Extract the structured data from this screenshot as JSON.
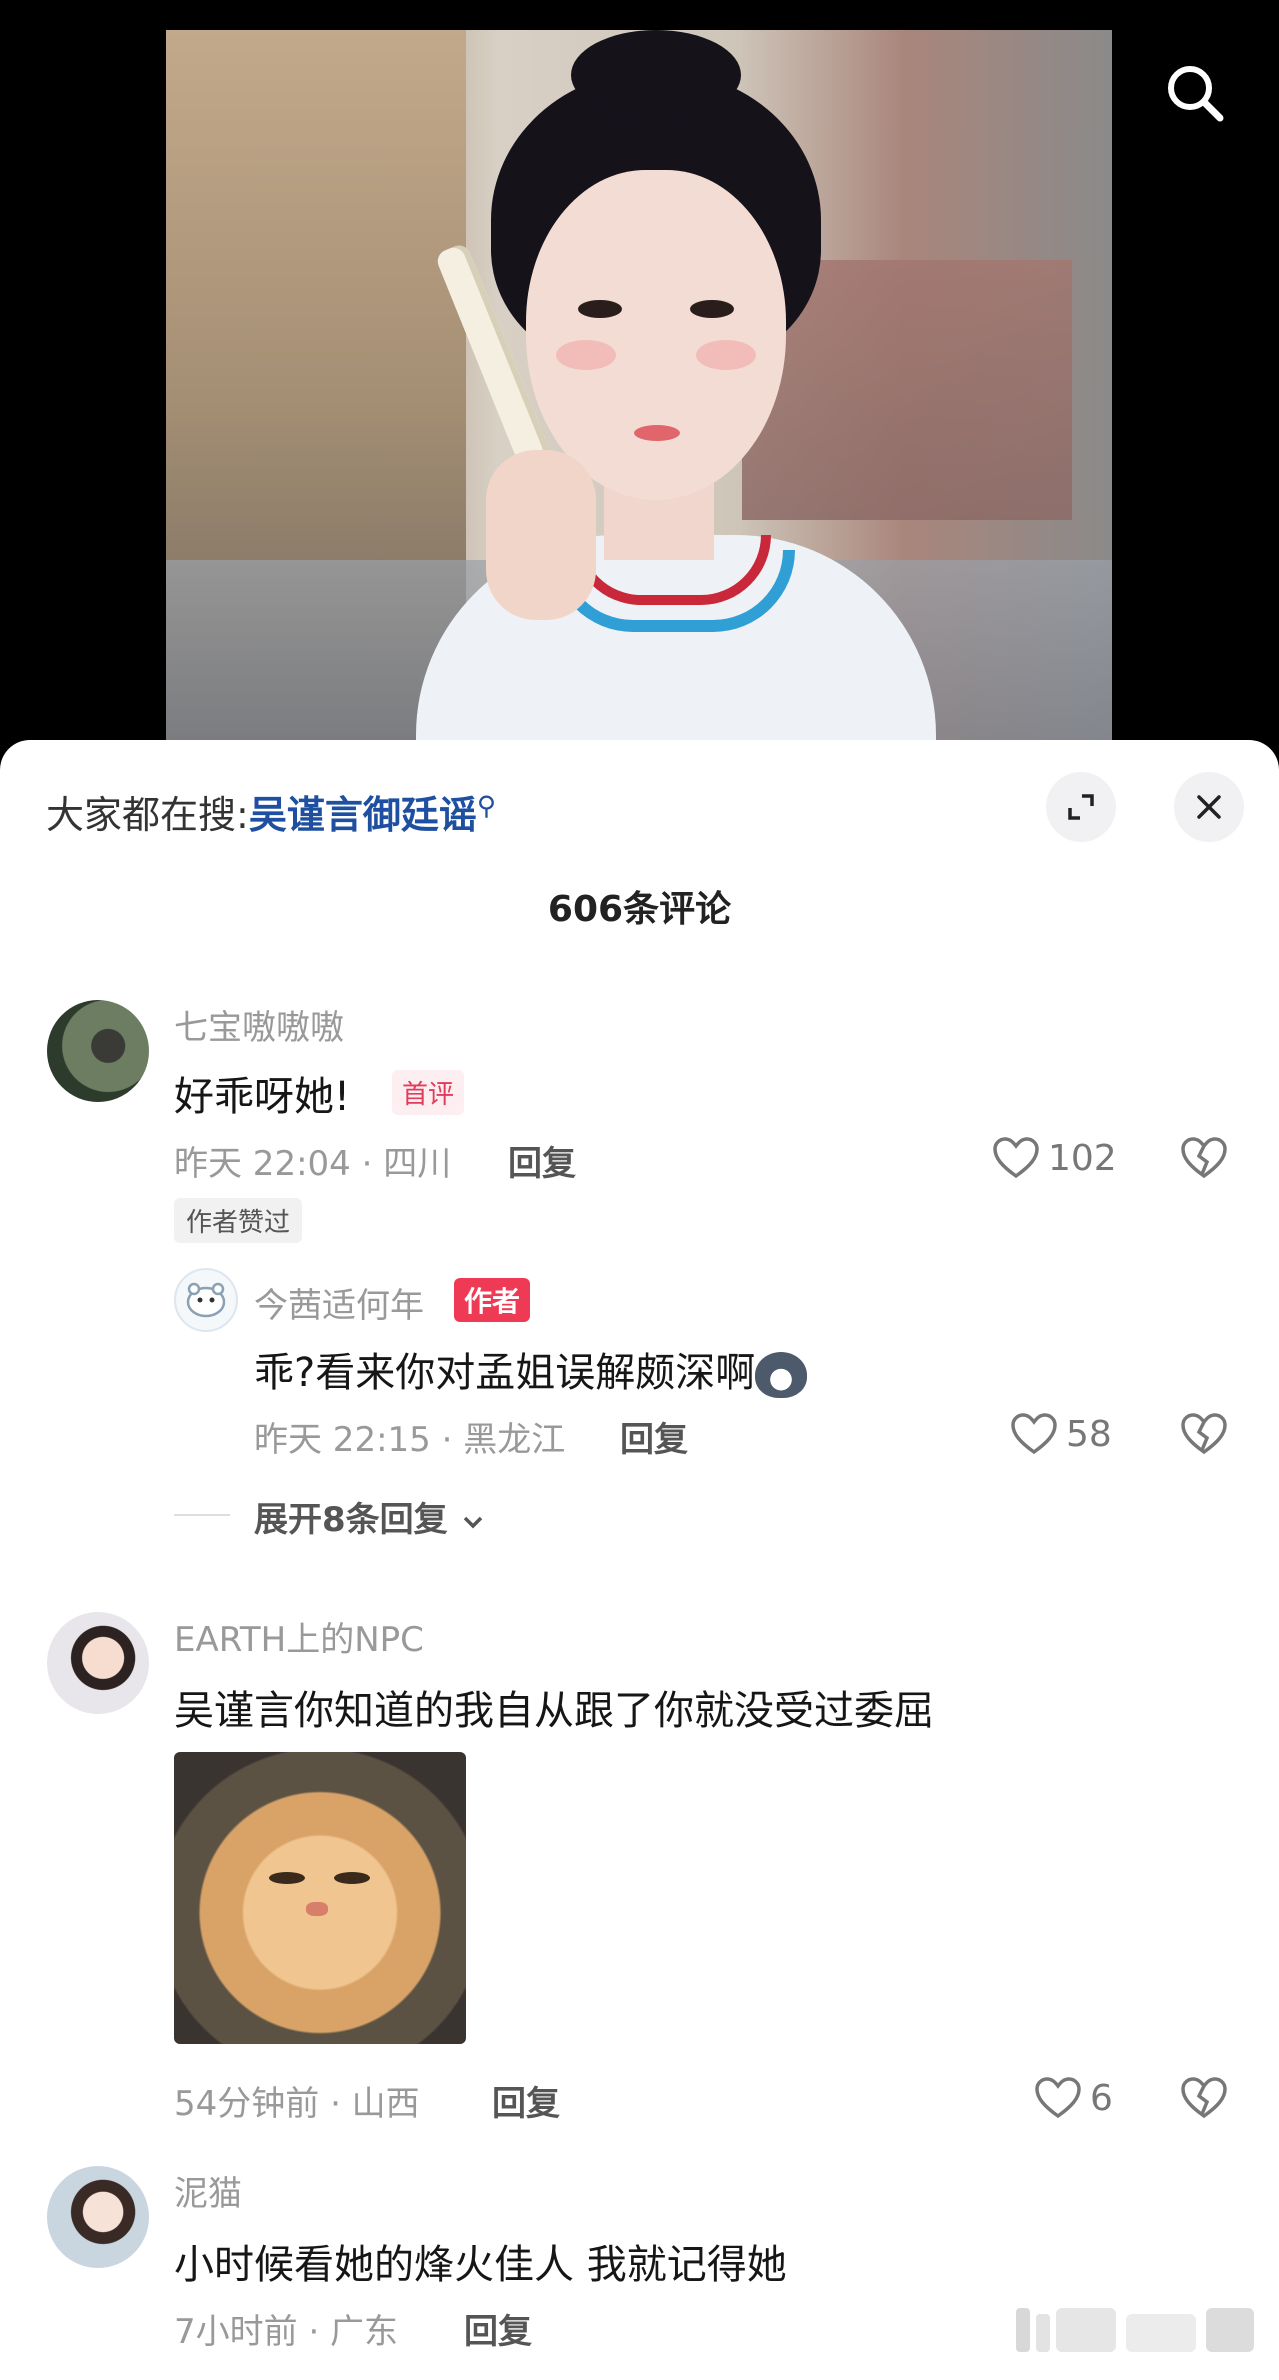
{
  "search_hint": {
    "prefix": "大家都在搜:",
    "keyword": "吴谨言御廷谣"
  },
  "comments_title": "606条评论",
  "comments": [
    {
      "username": "七宝嗷嗷嗷",
      "text": "好乖呀她!",
      "badge": "首评",
      "time_location": "昨天 22:04 · 四川",
      "reply_label": "回复",
      "likes": "102",
      "author_liked_tag": "作者赞过"
    },
    {
      "username": "EARTH上的NPC",
      "text": "吴谨言你知道的我自从跟了你就没受过委屈",
      "time_location": "54分钟前 · 山西",
      "reply_label": "回复",
      "likes": "6"
    },
    {
      "username": "泥猫",
      "text": "小时候看她的烽火佳人 我就记得她",
      "time_location": "7小时前 · 广东",
      "reply_label": "回复"
    }
  ],
  "reply": {
    "username": "今茜适何年",
    "author_tag": "作者",
    "text": "乖?看来你对孟姐误解颇深啊",
    "time_location": "昨天 22:15 · 黑龙江",
    "reply_label": "回复",
    "likes": "58"
  },
  "expand_replies": "展开8条回复",
  "colors": {
    "accent_blue": "#1e4fa0",
    "author_red": "#ef3a56",
    "first_tag": "#e23b5c"
  }
}
